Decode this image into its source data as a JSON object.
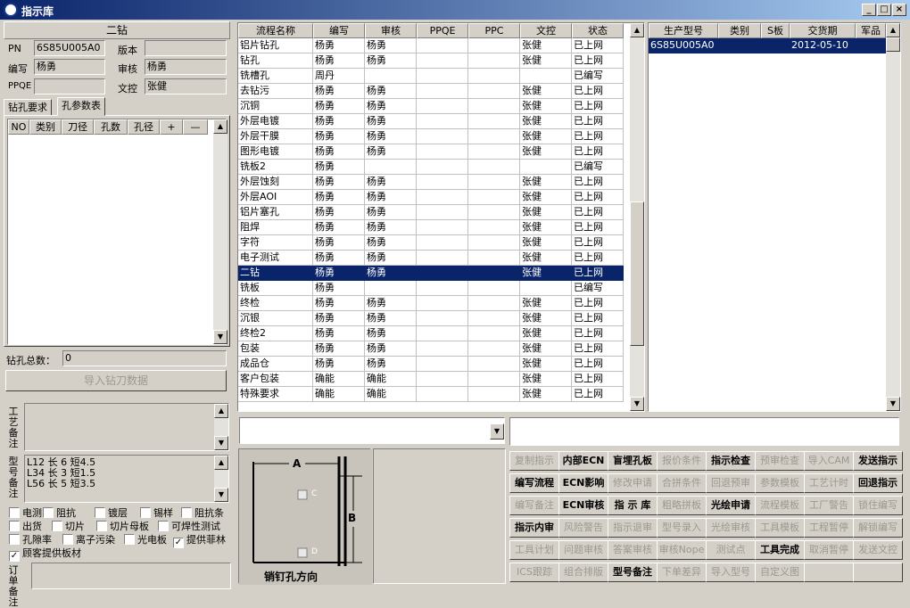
{
  "window": {
    "title": "指示库",
    "min": "_",
    "max": "□",
    "close": "×"
  },
  "left": {
    "panel_title": "二钻",
    "pn_label": "PN",
    "pn_value": "6S85U005A0",
    "version_label": "版本",
    "version_value": "",
    "writer_label": "编写",
    "writer_value": "杨勇",
    "review_label": "审核",
    "review_value": "杨勇",
    "ppqe_label": "PPQE",
    "ppqe_value": "",
    "dc_label": "文控",
    "dc_value": "张健",
    "tabs": [
      "钻孔要求",
      "孔参数表"
    ],
    "hole_columns": [
      "NO",
      "类别",
      "刀径",
      "孔数",
      "孔径",
      "+",
      "—"
    ],
    "total_label": "钻孔总数：",
    "total_value": "0",
    "import_button": "导入钻刀数据",
    "process_note_label": "工艺备注",
    "model_note_label": "型号备注",
    "model_note_lines": [
      "L12  长 6   短4.5",
      "L34  长 3   短1.5",
      "L56   长 5   短3.5"
    ],
    "checkboxes": [
      {
        "label": "电测",
        "checked": false
      },
      {
        "label": "阻抗",
        "checked": false
      },
      {
        "label": "镀层",
        "checked": false
      },
      {
        "label": "锡样",
        "checked": false
      },
      {
        "label": "阻抗条",
        "checked": false
      },
      {
        "label": "出货",
        "checked": false
      },
      {
        "label": "切片",
        "checked": false
      },
      {
        "label": "切片母板",
        "checked": false
      },
      {
        "label": "可焊性测试",
        "checked": false
      },
      {
        "label": "孔隙率",
        "checked": false
      },
      {
        "label": "离子污染",
        "checked": false
      },
      {
        "label": "光电板",
        "checked": false
      },
      {
        "label": "提供菲林",
        "checked": true
      },
      {
        "label": "顾客提供板材",
        "checked": true
      }
    ],
    "order_note_label": "订单备注"
  },
  "process": {
    "columns": [
      "流程名称",
      "编写",
      "审核",
      "PPQE",
      "PPC",
      "文控",
      "状态"
    ],
    "selected_index": 15,
    "rows": [
      [
        "铝片钻孔",
        "杨勇",
        "杨勇",
        "",
        "",
        "张健",
        "已上网"
      ],
      [
        "钻孔",
        "杨勇",
        "杨勇",
        "",
        "",
        "张健",
        "已上网"
      ],
      [
        "铣槽孔",
        "周丹",
        "",
        "",
        "",
        "",
        "已编写"
      ],
      [
        "去钻污",
        "杨勇",
        "杨勇",
        "",
        "",
        "张健",
        "已上网"
      ],
      [
        "沉铜",
        "杨勇",
        "杨勇",
        "",
        "",
        "张健",
        "已上网"
      ],
      [
        "外层电镀",
        "杨勇",
        "杨勇",
        "",
        "",
        "张健",
        "已上网"
      ],
      [
        "外层干膜",
        "杨勇",
        "杨勇",
        "",
        "",
        "张健",
        "已上网"
      ],
      [
        "图形电镀",
        "杨勇",
        "杨勇",
        "",
        "",
        "张健",
        "已上网"
      ],
      [
        "铣板2",
        "杨勇",
        "",
        "",
        "",
        "",
        "已编写"
      ],
      [
        "外层蚀刻",
        "杨勇",
        "杨勇",
        "",
        "",
        "张健",
        "已上网"
      ],
      [
        "外层AOI",
        "杨勇",
        "杨勇",
        "",
        "",
        "张健",
        "已上网"
      ],
      [
        "铝片塞孔",
        "杨勇",
        "杨勇",
        "",
        "",
        "张健",
        "已上网"
      ],
      [
        "阻焊",
        "杨勇",
        "杨勇",
        "",
        "",
        "张健",
        "已上网"
      ],
      [
        "字符",
        "杨勇",
        "杨勇",
        "",
        "",
        "张健",
        "已上网"
      ],
      [
        "电子测试",
        "杨勇",
        "杨勇",
        "",
        "",
        "张健",
        "已上网"
      ],
      [
        "二钻",
        "杨勇",
        "杨勇",
        "",
        "",
        "张健",
        "已上网"
      ],
      [
        "铣板",
        "杨勇",
        "",
        "",
        "",
        "",
        "已编写"
      ],
      [
        "终检",
        "杨勇",
        "杨勇",
        "",
        "",
        "张健",
        "已上网"
      ],
      [
        "沉银",
        "杨勇",
        "杨勇",
        "",
        "",
        "张健",
        "已上网"
      ],
      [
        "终检2",
        "杨勇",
        "杨勇",
        "",
        "",
        "张健",
        "已上网"
      ],
      [
        "包装",
        "杨勇",
        "杨勇",
        "",
        "",
        "张健",
        "已上网"
      ],
      [
        "成品仓",
        "杨勇",
        "杨勇",
        "",
        "",
        "张健",
        "已上网"
      ],
      [
        "客户包装",
        "确能",
        "确能",
        "",
        "",
        "张健",
        "已上网"
      ],
      [
        "特殊要求",
        "确能",
        "确能",
        "",
        "",
        "张健",
        "已上网"
      ]
    ]
  },
  "orders": {
    "columns": [
      "生产型号",
      "类别",
      "S板",
      "交货期",
      "军品"
    ],
    "rows": [
      [
        "6S85U005A0",
        "",
        "",
        "2012-05-10",
        ""
      ]
    ]
  },
  "diagram": {
    "label_a": "A",
    "label_b": "B",
    "label_c": "C",
    "label_d": "D",
    "caption": "销钉孔方向"
  },
  "buttons": [
    [
      {
        "t": "复制指示",
        "e": false
      },
      {
        "t": "内部ECN",
        "e": true
      },
      {
        "t": "盲埋孔板",
        "e": true
      },
      {
        "t": "报价条件",
        "e": false
      },
      {
        "t": "指示检查",
        "e": true
      },
      {
        "t": "预审检查",
        "e": false
      },
      {
        "t": "导入CAM",
        "e": false
      },
      {
        "t": "发送指示",
        "e": true
      }
    ],
    [
      {
        "t": "编写流程",
        "e": true
      },
      {
        "t": "ECN影响",
        "e": true
      },
      {
        "t": "修改申请",
        "e": false
      },
      {
        "t": "合拼条件",
        "e": false
      },
      {
        "t": "回退预审",
        "e": false
      },
      {
        "t": "参数模板",
        "e": false
      },
      {
        "t": "工艺计时",
        "e": false
      },
      {
        "t": "回退指示",
        "e": true
      }
    ],
    [
      {
        "t": "编写备注",
        "e": false
      },
      {
        "t": "ECN审核",
        "e": true
      },
      {
        "t": "指 示 库",
        "e": true
      },
      {
        "t": "粗略拼板",
        "e": false
      },
      {
        "t": "光绘申请",
        "e": true
      },
      {
        "t": "流程模板",
        "e": false
      },
      {
        "t": "工厂警告",
        "e": false
      },
      {
        "t": "锁住编写",
        "e": false
      }
    ],
    [
      {
        "t": "指示内审",
        "e": true
      },
      {
        "t": "风险警告",
        "e": false
      },
      {
        "t": "指示退审",
        "e": false
      },
      {
        "t": "型号录入",
        "e": false
      },
      {
        "t": "光绘审核",
        "e": false
      },
      {
        "t": "工具模板",
        "e": false
      },
      {
        "t": "工程暂停",
        "e": false
      },
      {
        "t": "解锁编写",
        "e": false
      }
    ],
    [
      {
        "t": "工具计划",
        "e": false
      },
      {
        "t": "问题审核",
        "e": false
      },
      {
        "t": "答案审核",
        "e": false
      },
      {
        "t": "审核Nope",
        "e": false
      },
      {
        "t": "测试点",
        "e": false
      },
      {
        "t": "工具完成",
        "e": true
      },
      {
        "t": "取消暂停",
        "e": false
      },
      {
        "t": "发送文控",
        "e": false
      }
    ],
    [
      {
        "t": "ICS跟踪",
        "e": false
      },
      {
        "t": "组合排版",
        "e": false
      },
      {
        "t": "型号备注",
        "e": true
      },
      {
        "t": "下单差异",
        "e": false
      },
      {
        "t": "导入型号",
        "e": false
      },
      {
        "t": "自定义图",
        "e": false
      }
    ]
  ]
}
